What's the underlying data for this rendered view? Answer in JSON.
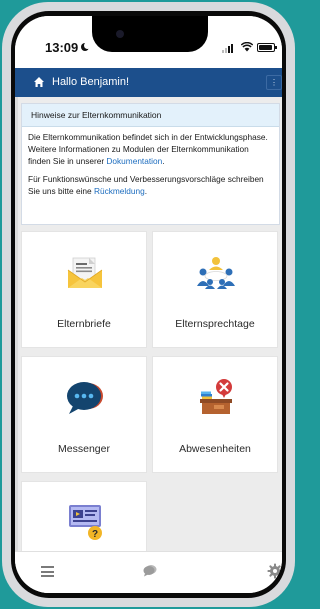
{
  "status_bar": {
    "time": "13:09",
    "icons": [
      "moon-icon",
      "signal-icon",
      "wifi-icon",
      "battery-icon"
    ]
  },
  "navbar": {
    "title": "Hallo Benjamin!",
    "home_icon": "home-icon",
    "more_label": "⋮",
    "color": "#1c4f8c"
  },
  "notice": {
    "header": "Hinweise zur Elternkommunikation",
    "paragraph1": "Die Elternkommunikation befindet sich in der Entwicklungsphase. Weitere Informationen zu Modulen der Elternkommunikation finden Sie in unserer ",
    "paragraph1_link": "Dokumentation",
    "paragraph1_end": ".",
    "paragraph2": "Für Funktionswünsche und Verbesserungsvorschläge schreiben Sie uns bitte eine ",
    "paragraph2_link": "Rückmeldung",
    "paragraph2_end": ".",
    "header_color": "#e3f1fb",
    "link_color": "#1d6dbf"
  },
  "tiles": [
    {
      "label": "Elternbriefe",
      "icon": "letter-envelope-icon"
    },
    {
      "label": "Elternsprechtage",
      "icon": "meeting-table-icon"
    },
    {
      "label": "Messenger",
      "icon": "chat-bubbles-icon"
    },
    {
      "label": "Abwesenheiten",
      "icon": "absent-desk-icon"
    },
    {
      "label": "",
      "icon": "video-help-icon"
    }
  ],
  "tab_bar": {
    "icons": [
      "menu-icon",
      "chat-icon",
      "gear-icon"
    ]
  },
  "background_color": "#1f9a9a"
}
